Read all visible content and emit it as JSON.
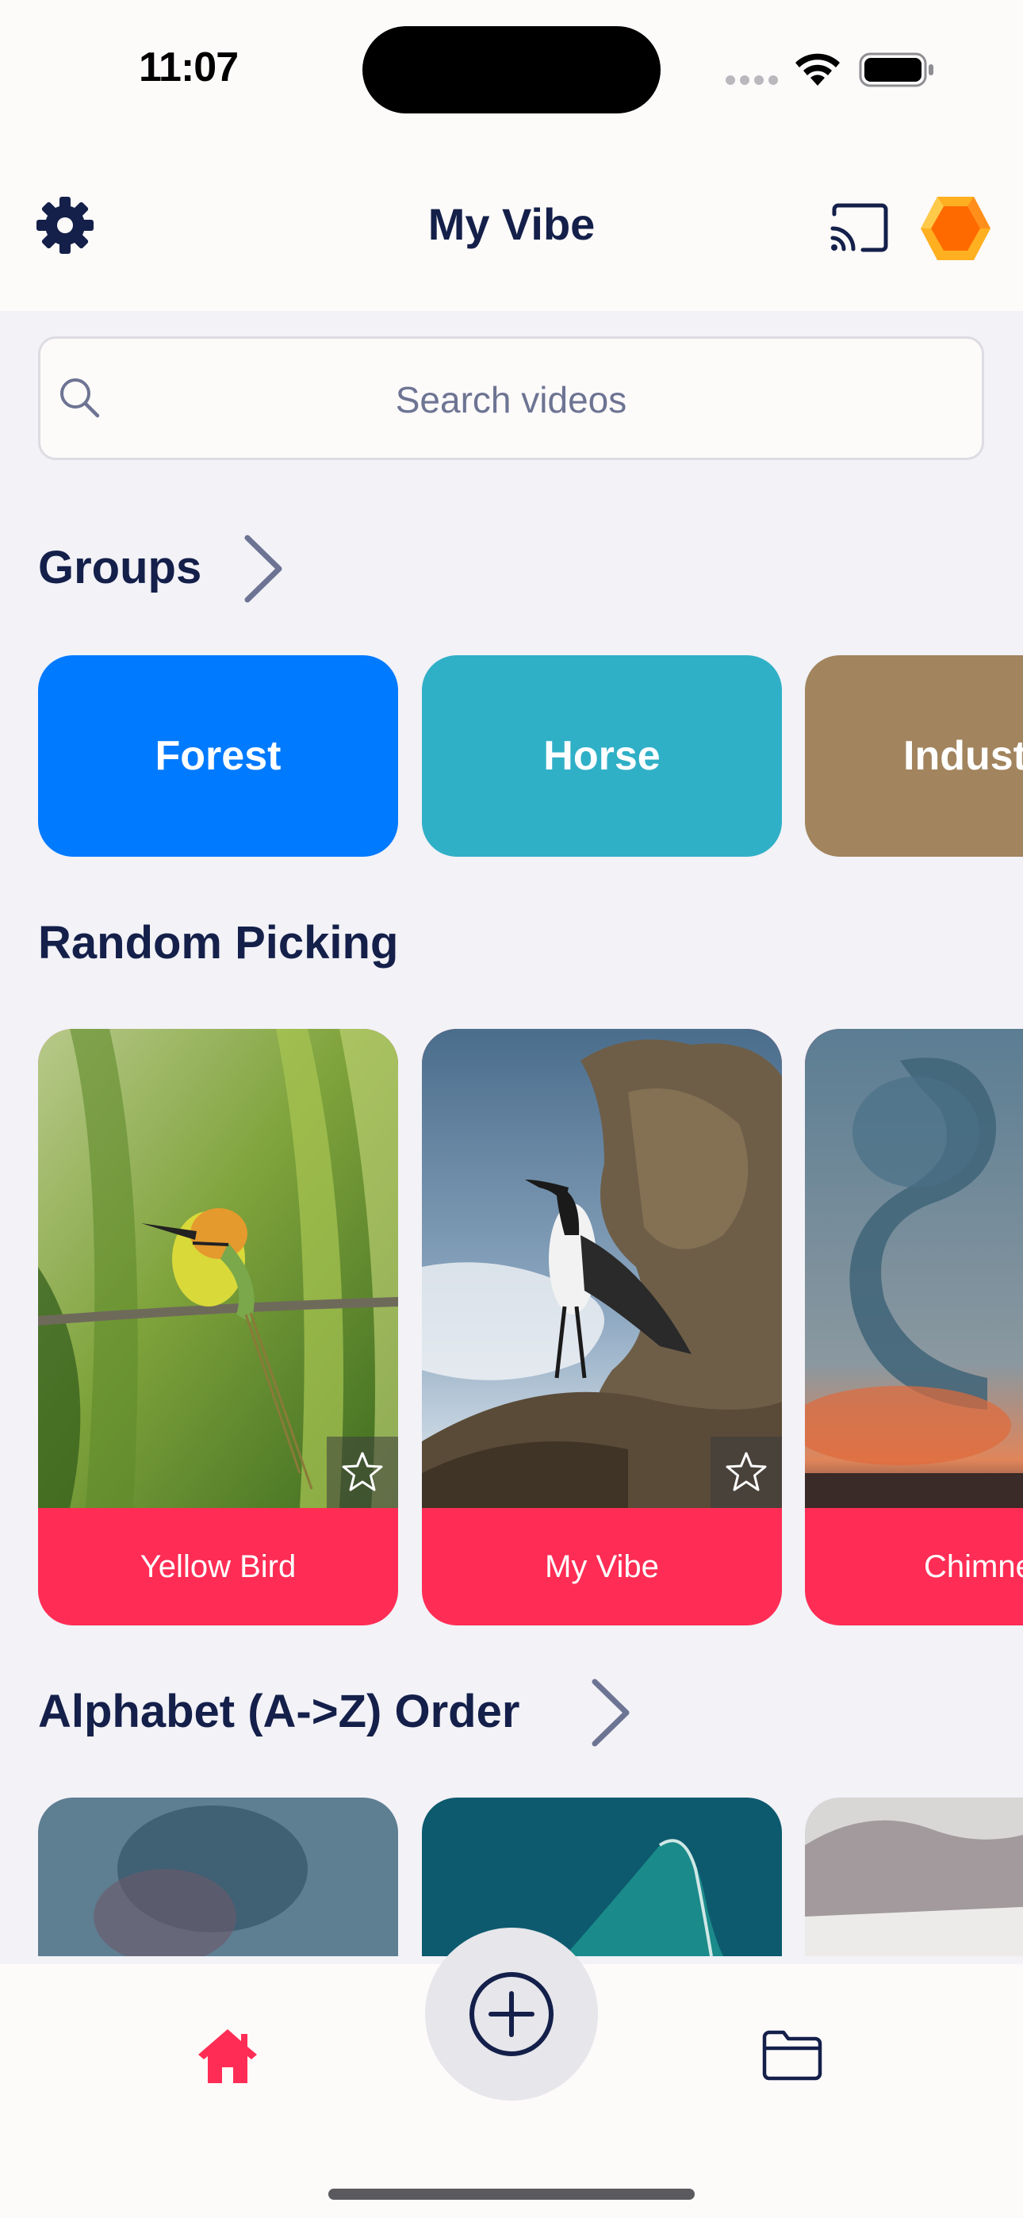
{
  "status_bar": {
    "time": "11:07"
  },
  "header": {
    "title": "My Vibe",
    "icons": {
      "settings": "gear-icon",
      "cast": "cast-icon",
      "premium": "hexagon-gem-icon"
    },
    "colors": {
      "title": "#14204a",
      "premium_outer": "#ff9f0a",
      "premium_inner": "#ff6a00"
    }
  },
  "search": {
    "placeholder": "Search videos",
    "icon": "search-icon"
  },
  "groups": {
    "title": "Groups",
    "items": [
      {
        "label": "Forest",
        "color": "#007aff"
      },
      {
        "label": "Horse",
        "color": "#30b0c7"
      },
      {
        "label": "Indust",
        "color": "#a2845e"
      }
    ]
  },
  "random_picking": {
    "title": "Random Picking",
    "items": [
      {
        "label": "Yellow Bird",
        "favorite": false
      },
      {
        "label": "My Vibe",
        "favorite": false
      },
      {
        "label": "Chimne",
        "favorite": false
      }
    ],
    "label_color": "#ff2d55"
  },
  "alphabet_order": {
    "title": "Alphabet (A->Z) Order"
  },
  "tab_bar": {
    "items": [
      {
        "name": "home",
        "icon": "house-icon",
        "active": true
      },
      {
        "name": "add",
        "icon": "plus-circle-icon"
      },
      {
        "name": "files",
        "icon": "folder-icon"
      }
    ],
    "active_color": "#ff2d55"
  }
}
